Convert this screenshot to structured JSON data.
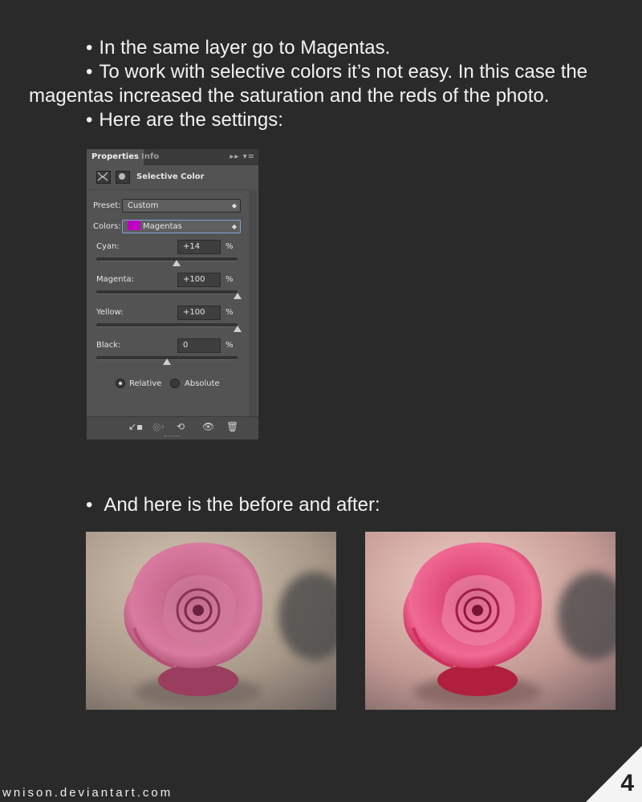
{
  "text": {
    "bullet": "•",
    "line1": "In the same layer go to Magentas.",
    "line2a": "To work with selective colors it’s not easy. In this case the",
    "line2b": "magentas increased the saturation and the reds of the photo.",
    "line3": "Here are the settings:",
    "line4": "And here is the before and after:"
  },
  "panel": {
    "tabs": [
      "Properties",
      "Info"
    ],
    "title": "Selective Color",
    "preset_label": "Preset:",
    "preset_value": "Custom",
    "colors_label": "Colors:",
    "colors_value": "Magentas",
    "swatch_color": "#c000c0",
    "sliders": [
      {
        "label": "Cyan:",
        "value": "+14",
        "unit": "%",
        "level": 0.57
      },
      {
        "label": "Magenta:",
        "value": "+100",
        "unit": "%",
        "level": 1.0
      },
      {
        "label": "Yellow:",
        "value": "+100",
        "unit": "%",
        "level": 1.0
      },
      {
        "label": "Black:",
        "value": "0",
        "unit": "%",
        "level": 0.5
      }
    ],
    "method_options": [
      "Relative",
      "Absolute"
    ],
    "method_selected": "Relative"
  },
  "footer": {
    "credit": "wnison.deviantart.com",
    "page_number": "4"
  }
}
